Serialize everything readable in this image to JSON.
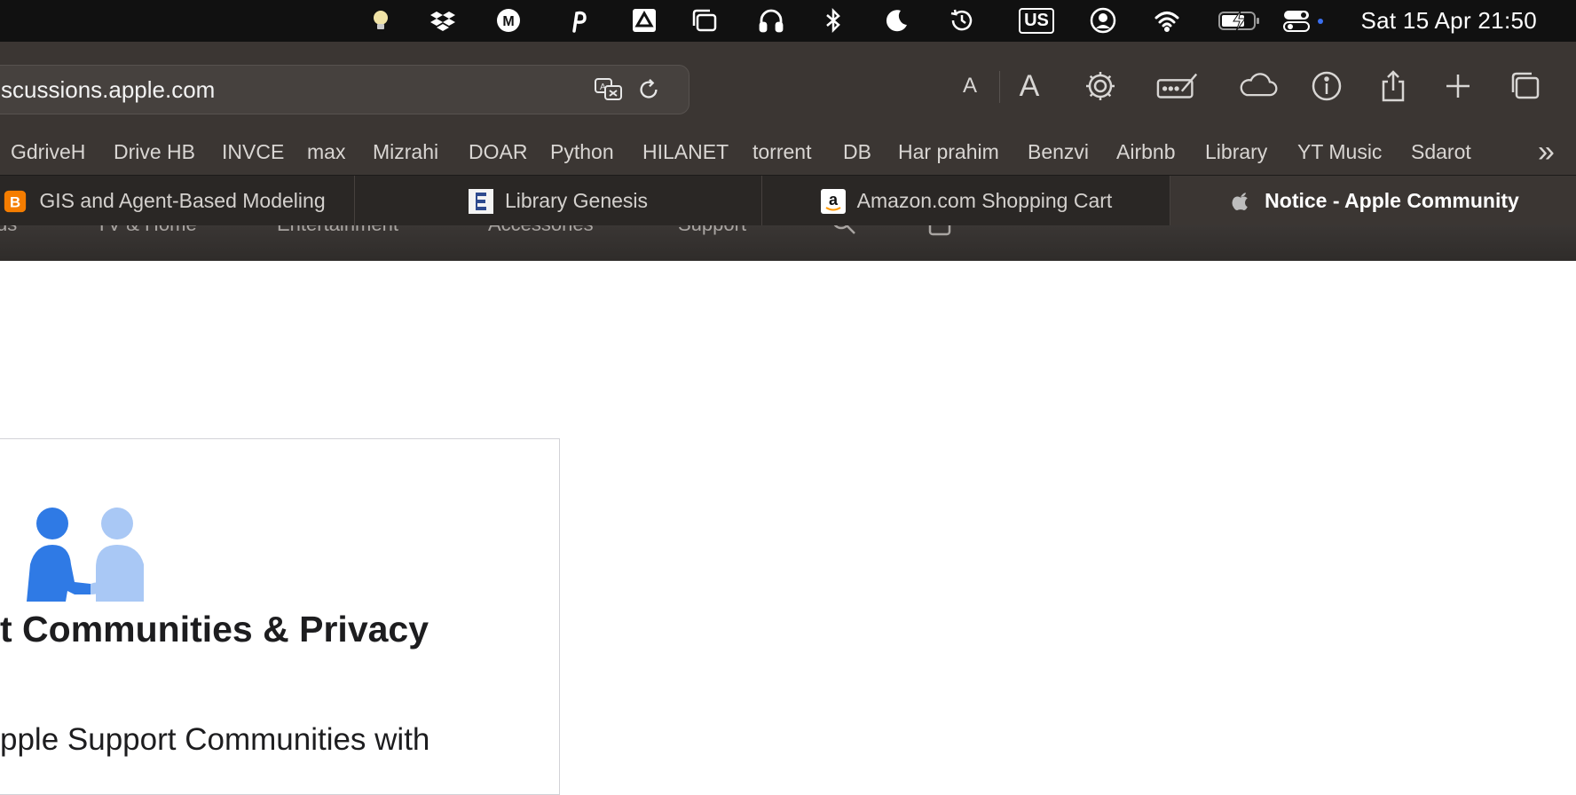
{
  "menubar": {
    "clock": "Sat 15 Apr  21:50",
    "keyboard_layout": "US",
    "icons": [
      "lightbulb-icon",
      "dropbox-icon",
      "m-icon",
      "p-icon",
      "drive-icon",
      "windows-icon",
      "headphones-icon",
      "bluetooth-icon",
      "moon-icon",
      "time-machine-icon",
      "keyboard-layout-icon",
      "user-icon",
      "wifi-icon",
      "battery-icon",
      "control-center-icon"
    ]
  },
  "browser": {
    "url": "scussions.apple.com",
    "text_small": "A",
    "text_large": "A",
    "bookmarks": [
      "GdriveH",
      "Drive HB",
      "INVCE",
      "max",
      "Mizrahi",
      "DOAR",
      "Python",
      "HILANET",
      "torrent",
      "DB",
      "Har prahim",
      "Benzvi",
      "Airbnb",
      "Library",
      "YT Music",
      "Sdarot"
    ],
    "tabs": [
      {
        "title": "GIS and Agent-Based Modeling",
        "favicon": "blogger-icon"
      },
      {
        "title": "Library Genesis",
        "favicon": "library-genesis-icon"
      },
      {
        "title": "Amazon.com Shopping Cart",
        "favicon": "amazon-icon"
      },
      {
        "title": "Notice - Apple Community",
        "favicon": "apple-icon",
        "active": true
      }
    ]
  },
  "globalnav": {
    "items": [
      "us",
      "TV & Home",
      "Entertainment",
      "Accessories",
      "Support"
    ]
  },
  "page": {
    "card_title": "t Communities & Privacy",
    "card_body": "pple Support Communities with"
  },
  "colors": {
    "menubar_bg": "#111111",
    "toolbar_bg": "#3b3633",
    "tabbar_bg": "#2a2725",
    "people_dark": "#2f7ae5",
    "people_light": "#a9c8f5"
  }
}
